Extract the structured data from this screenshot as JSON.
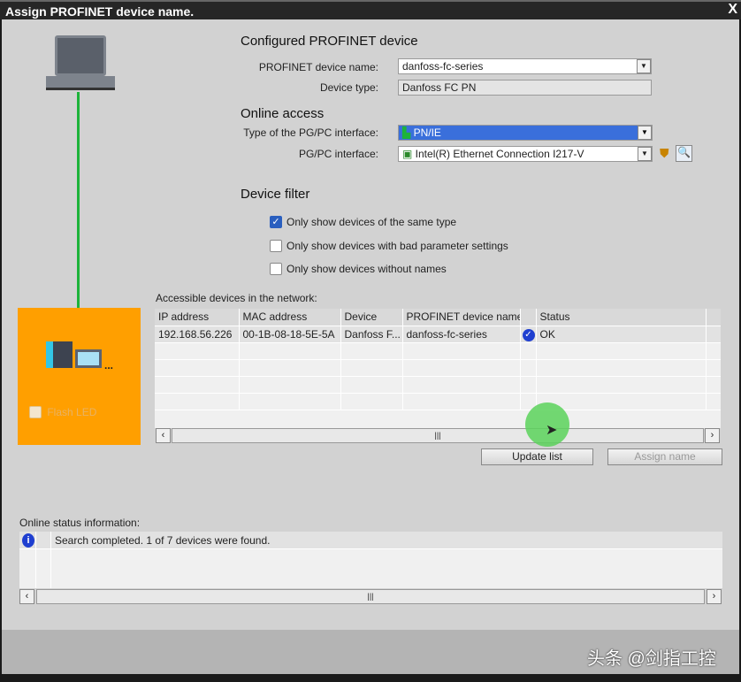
{
  "title": "Assign PROFINET device name.",
  "configured": {
    "heading": "Configured PROFINET device",
    "name_label": "PROFINET device name:",
    "name_value": "danfoss-fc-series",
    "type_label": "Device type:",
    "type_value": "Danfoss FC PN"
  },
  "online": {
    "heading": "Online access",
    "iface_type_label": "Type of the PG/PC interface:",
    "iface_type_value": "PN/IE",
    "iface_label": "PG/PC interface:",
    "iface_value": "Intel(R) Ethernet Connection I217-V"
  },
  "filter": {
    "heading": "Device filter",
    "options": [
      {
        "label": "Only show devices of the same type",
        "checked": true
      },
      {
        "label": "Only show devices with bad parameter settings",
        "checked": false
      },
      {
        "label": "Only show devices without names",
        "checked": false
      }
    ]
  },
  "device_panel": {
    "flash_led": "Flash LED",
    "color": "#ff9f00"
  },
  "devices": {
    "caption": "Accessible devices in the network:",
    "columns": [
      "IP address",
      "MAC address",
      "Device",
      "PROFINET device name",
      "",
      "Status"
    ],
    "rows": [
      [
        "192.168.56.226",
        "00-1B-08-18-5E-5A",
        "Danfoss F...",
        "danfoss-fc-series",
        "ok-icon",
        "OK"
      ]
    ]
  },
  "buttons": {
    "update": "Update list",
    "assign": "Assign name"
  },
  "status": {
    "caption": "Online status information:",
    "messages": [
      "Search completed. 1 of 7 devices were found."
    ]
  },
  "watermark": "头条 @剑指工控"
}
